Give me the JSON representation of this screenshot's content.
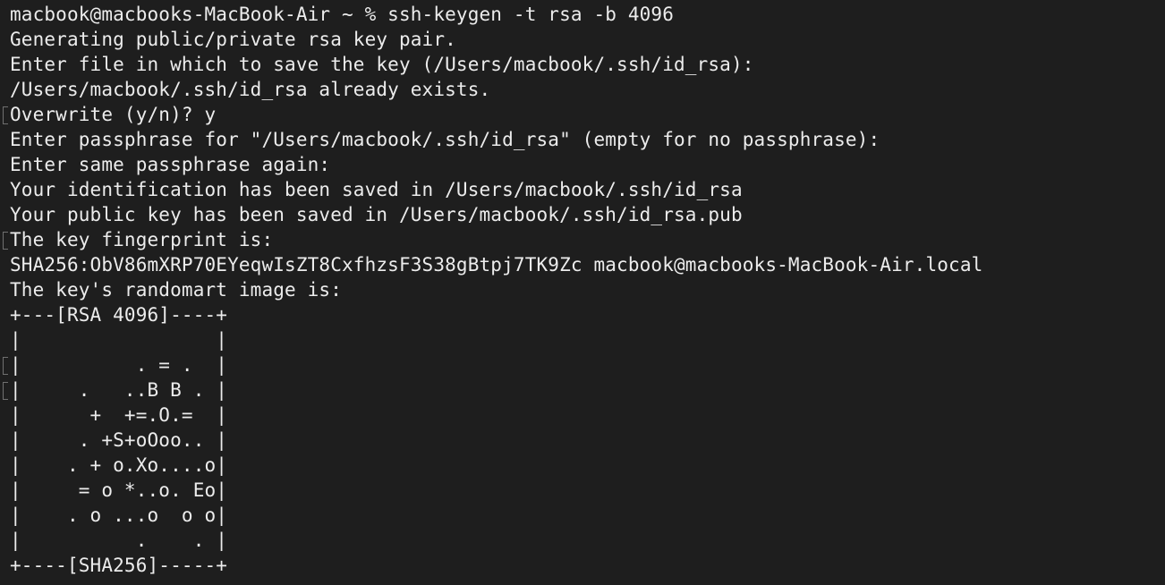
{
  "terminal": {
    "lines": [
      "macbook@macbooks-MacBook-Air ~ % ssh-keygen -t rsa -b 4096",
      "Generating public/private rsa key pair.",
      "Enter file in which to save the key (/Users/macbook/.ssh/id_rsa):",
      "/Users/macbook/.ssh/id_rsa already exists.",
      "Overwrite (y/n)? y",
      "Enter passphrase for \"/Users/macbook/.ssh/id_rsa\" (empty for no passphrase):",
      "Enter same passphrase again:",
      "Your identification has been saved in /Users/macbook/.ssh/id_rsa",
      "Your public key has been saved in /Users/macbook/.ssh/id_rsa.pub",
      "The key fingerprint is:",
      "SHA256:ObV86mXRP70EYeqwIsZT8CxfhzsF3S38gBtpj7TK9Zc macbook@macbooks-MacBook-Air.local",
      "The key's randomart image is:",
      "+---[RSA 4096]----+",
      "|                 |",
      "|          . = .  |",
      "|     .   ..B B . |",
      "|      +  +=.O.=  |",
      "|     . +S+oOoo.. |",
      "|    . + o.Xo....o|",
      "|     = o *..o. Eo|",
      "|    . o ...o  o o|",
      "|          .    . |",
      "+----[SHA256]-----+",
      ""
    ]
  }
}
